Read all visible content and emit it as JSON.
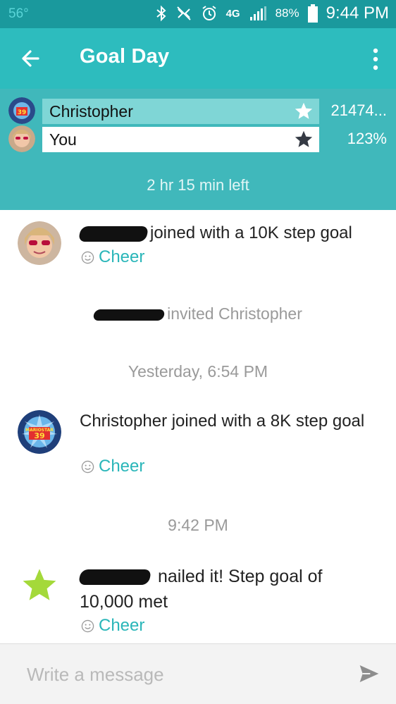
{
  "status_bar": {
    "temperature": "56°",
    "network": "4G",
    "battery_percent": "88%",
    "time": "9:44 PM",
    "icons": [
      "bluetooth-icon",
      "vibrate-mute-icon",
      "alarm-icon",
      "network-4g-icon",
      "signal-icon",
      "battery-icon"
    ]
  },
  "app_bar": {
    "title": "Goal Day",
    "back_icon": "arrow-left-icon",
    "menu_icon": "overflow-menu-icon"
  },
  "leaderboard": {
    "participants": [
      {
        "name": "Christopher",
        "value": "21474...",
        "star": "white"
      },
      {
        "name": "You",
        "value": "123%",
        "star": "dark"
      }
    ],
    "time_left": "2 hr 15 min left"
  },
  "feed": {
    "items": [
      {
        "type": "event",
        "text": "joined with a 10K step goal",
        "cheer": "Cheer"
      },
      {
        "type": "notice",
        "text": "invited Christopher"
      },
      {
        "type": "timestamp",
        "text": "Yesterday, 6:54 PM"
      },
      {
        "type": "event",
        "text": "Christopher joined with a 8K step goal",
        "cheer": "Cheer"
      },
      {
        "type": "timestamp",
        "text": "9:42 PM"
      },
      {
        "type": "event",
        "text_line1": "nailed it! Step goal of",
        "text_line2": "10,000 met",
        "cheer": "Cheer"
      }
    ]
  },
  "composer": {
    "placeholder": "Write a message",
    "send_icon": "send-icon"
  },
  "colors": {
    "status_bar": "#1a999d",
    "app_bar": "#2dbcbe",
    "board": "#40b8bb",
    "leader_bar": "#7fd6d6",
    "accent": "#2ab6b9",
    "star_green": "#a4d93a"
  }
}
